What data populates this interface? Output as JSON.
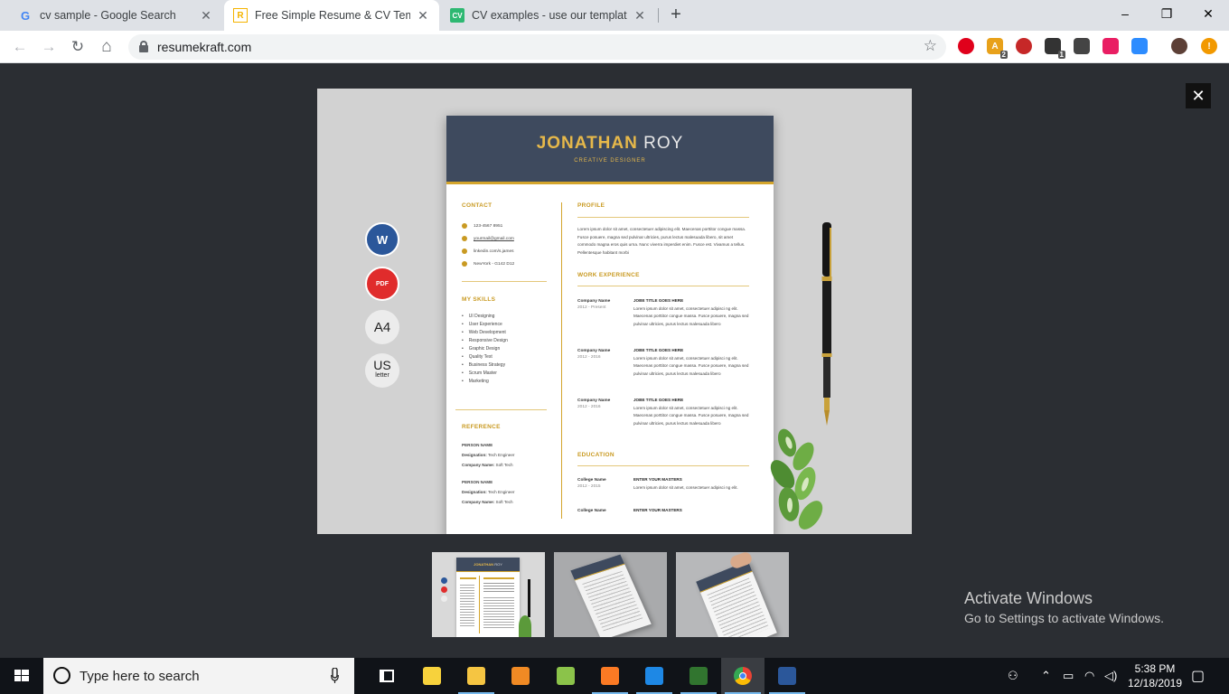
{
  "browser": {
    "tabs": [
      {
        "title": "cv sample - Google Search",
        "favicon": "G",
        "active": false
      },
      {
        "title": "Free Simple Resume & CV Templ",
        "favicon": "R",
        "active": true
      },
      {
        "title": "CV examples - use our templates",
        "favicon": "CV",
        "active": false
      }
    ],
    "new_tab": "+",
    "window_controls": {
      "minimize": "–",
      "maximize": "❐",
      "close": "✕"
    },
    "nav": {
      "back": "←",
      "forward": "→",
      "reload": "↻",
      "home": "⌂"
    },
    "url": "resumekraft.com",
    "bookmark_star": "☆",
    "extensions": [
      {
        "name": "ublock-icon",
        "label": "",
        "color": "#e0001b"
      },
      {
        "name": "extension-a-icon",
        "label": "A",
        "color": "#e8a11a",
        "badge": "2"
      },
      {
        "name": "devil-icon",
        "label": "",
        "color": "#c62828"
      },
      {
        "name": "box-icon",
        "label": "",
        "color": "#333333",
        "badge": "1"
      },
      {
        "name": "cube-icon",
        "label": "",
        "color": "#444444"
      },
      {
        "name": "pinwheel-icon",
        "label": "",
        "color": "#e91e63"
      },
      {
        "name": "zoom-icon",
        "label": "",
        "color": "#2d8cff"
      },
      {
        "name": "profile-avatar",
        "label": "",
        "color": "#5d4037"
      },
      {
        "name": "warning-icon",
        "label": "!",
        "color": "#f29900"
      }
    ]
  },
  "lightbox": {
    "close": "✕",
    "formats": [
      {
        "name": "word-format-button",
        "label": "W"
      },
      {
        "name": "pdf-format-button",
        "label": "PDF"
      },
      {
        "name": "a4-format-button",
        "label": "A4"
      },
      {
        "name": "us-letter-format-button",
        "label": "US",
        "sub": "letter"
      }
    ]
  },
  "resume": {
    "first_name": "JONATHAN",
    "last_name": "ROY",
    "role": "CREATIVE DESIGNER",
    "contact_title": "CONTACT",
    "contact": [
      "123-4567 8951",
      "yourmail@gmail.com",
      "linkedin.com/s.james",
      "NewYork - G142 D12"
    ],
    "skills_title": "MY SKILLS",
    "skills": [
      "UI Designing",
      "User Experience",
      "Web Development",
      "Responsive Design",
      "Graphic Design",
      "Quality Test",
      "Business Strategy",
      "Scrum Master",
      "Marketing"
    ],
    "reference_title": "REFERENCE",
    "references": [
      {
        "name": "PERSON NAME",
        "designation_label": "Designation:",
        "designation": "Tech Engineer",
        "company_label": "Company Name:",
        "company": "Soft Tech"
      },
      {
        "name": "PERSON NAME",
        "designation_label": "Designation:",
        "designation": "Tech Engineer",
        "company_label": "Company Name:",
        "company": "Soft Tech"
      }
    ],
    "profile_title": "PROFILE",
    "profile_text": "Lorem ipsum dolor sit amet, consectetuer adipiscing elit. Maecenas porttitor congue massa. Fusce posuere, magna sed pulvinar ultricies, purus lectus malesuada libero, sit amet commodo magna eros quis urna. Nunc viverra imperdiet enim. Fusce est. Vivamus a tellus. Pellentesque habitant morbi",
    "work_title": "WORK EXPERIENCE",
    "work": [
      {
        "company": "Company Name",
        "dates": "2012 - Present",
        "job": "JOBE TITLE GOES HERE",
        "text": "Lorem ipsum dolor sit amet, consectetuer adipisci ng elit. Maecenas porttitor congue massa. Fusce posuere, magna sed pulvinar ultricies, purus lectus malesuada libero"
      },
      {
        "company": "Company Name",
        "dates": "2012 - 2016",
        "job": "JOBE TITLE GOES HERE",
        "text": "Lorem ipsum dolor sit amet, consectetuer adipisci ng elit. Maecenas porttitor congue massa. Fusce posuere, magna sed pulvinar ultricies, purus lectus malesuada libero"
      },
      {
        "company": "Company Name",
        "dates": "2012 - 2016",
        "job": "JOBE TITLE GOES HERE",
        "text": "Lorem ipsum dolor sit amet, consectetuer adipisci ng elit. Maecenas porttitor congue massa. Fusce posuere, magna sed pulvinar ultricies, purus lectus malesuada libero"
      }
    ],
    "education_title": "EDUCATION",
    "education": [
      {
        "college": "College Name",
        "dates": "2012 - 2015",
        "degree": "ENTER YOUR MASTERS",
        "text": "Lorem ipsum dolor sit amet, consectetuer adipisci ng elit."
      },
      {
        "college": "College Name",
        "dates": "",
        "degree": "ENTER YOUR MASTERS",
        "text": ""
      }
    ]
  },
  "thumbnails": {
    "thumb_name_first": "JONATHAN",
    "thumb_name_last": "ROY"
  },
  "watermark": {
    "title": "Activate Windows",
    "subtitle": "Go to Settings to activate Windows."
  },
  "taskbar": {
    "search_placeholder": "Type here to search",
    "apps": [
      {
        "name": "task-view-icon",
        "color": "#ffffff"
      },
      {
        "name": "sticky-notes-icon",
        "color": "#f7d23c"
      },
      {
        "name": "file-explorer-icon",
        "color": "#f5c542"
      },
      {
        "name": "media-player-icon",
        "color": "#f08a24"
      },
      {
        "name": "lambda-app-icon",
        "color": "#8bc34a"
      },
      {
        "name": "xampp-icon",
        "color": "#fb7a24"
      },
      {
        "name": "vscode-icon",
        "color": "#1e88e5"
      },
      {
        "name": "project-icon",
        "color": "#31752f"
      },
      {
        "name": "chrome-icon",
        "color": "#4285f4"
      },
      {
        "name": "word-icon",
        "color": "#2b579a"
      }
    ],
    "time": "5:38 PM",
    "date": "12/18/2019"
  }
}
